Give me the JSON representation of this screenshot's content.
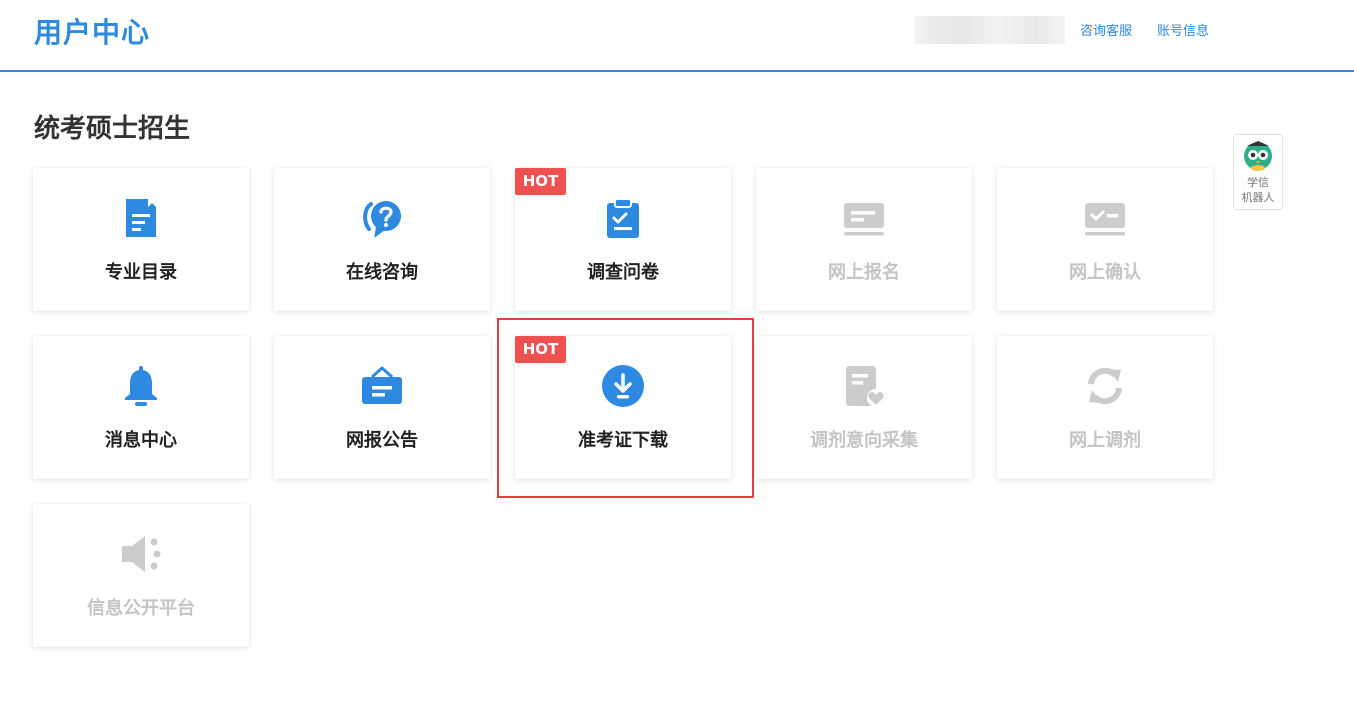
{
  "header": {
    "logo": "用户中心",
    "links": {
      "consult": "咨询客服",
      "account": "账号信息"
    }
  },
  "page": {
    "title": "统考硕士招生"
  },
  "cards": {
    "major_catalog": {
      "label": "专业目录",
      "icon": "document-icon"
    },
    "online_consult": {
      "label": "在线咨询",
      "icon": "question-bubble-icon"
    },
    "survey": {
      "label": "调查问卷",
      "icon": "clipboard-check-icon",
      "badge": "HOT"
    },
    "online_register": {
      "label": "网上报名",
      "icon": "id-card-icon",
      "disabled": true
    },
    "online_confirm": {
      "label": "网上确认",
      "icon": "confirm-card-icon",
      "disabled": true
    },
    "message_center": {
      "label": "消息中心",
      "icon": "bell-icon"
    },
    "announcement": {
      "label": "网报公告",
      "icon": "notice-board-icon"
    },
    "admission_ticket": {
      "label": "准考证下载",
      "icon": "download-icon",
      "badge": "HOT"
    },
    "adjust_intent": {
      "label": "调剂意向采集",
      "icon": "document-heart-icon",
      "disabled": true
    },
    "online_adjust": {
      "label": "网上调剂",
      "icon": "refresh-icon",
      "disabled": true
    },
    "info_public": {
      "label": "信息公开平台",
      "icon": "speaker-icon",
      "disabled": true
    }
  },
  "robot": {
    "line1": "学信",
    "line2": "机器人",
    "icon": "owl-robot-icon"
  },
  "colors": {
    "primary": "#2d8ae0",
    "disabled": "#cccccc",
    "hot": "#f05050",
    "highlight": "#e83d3d"
  }
}
